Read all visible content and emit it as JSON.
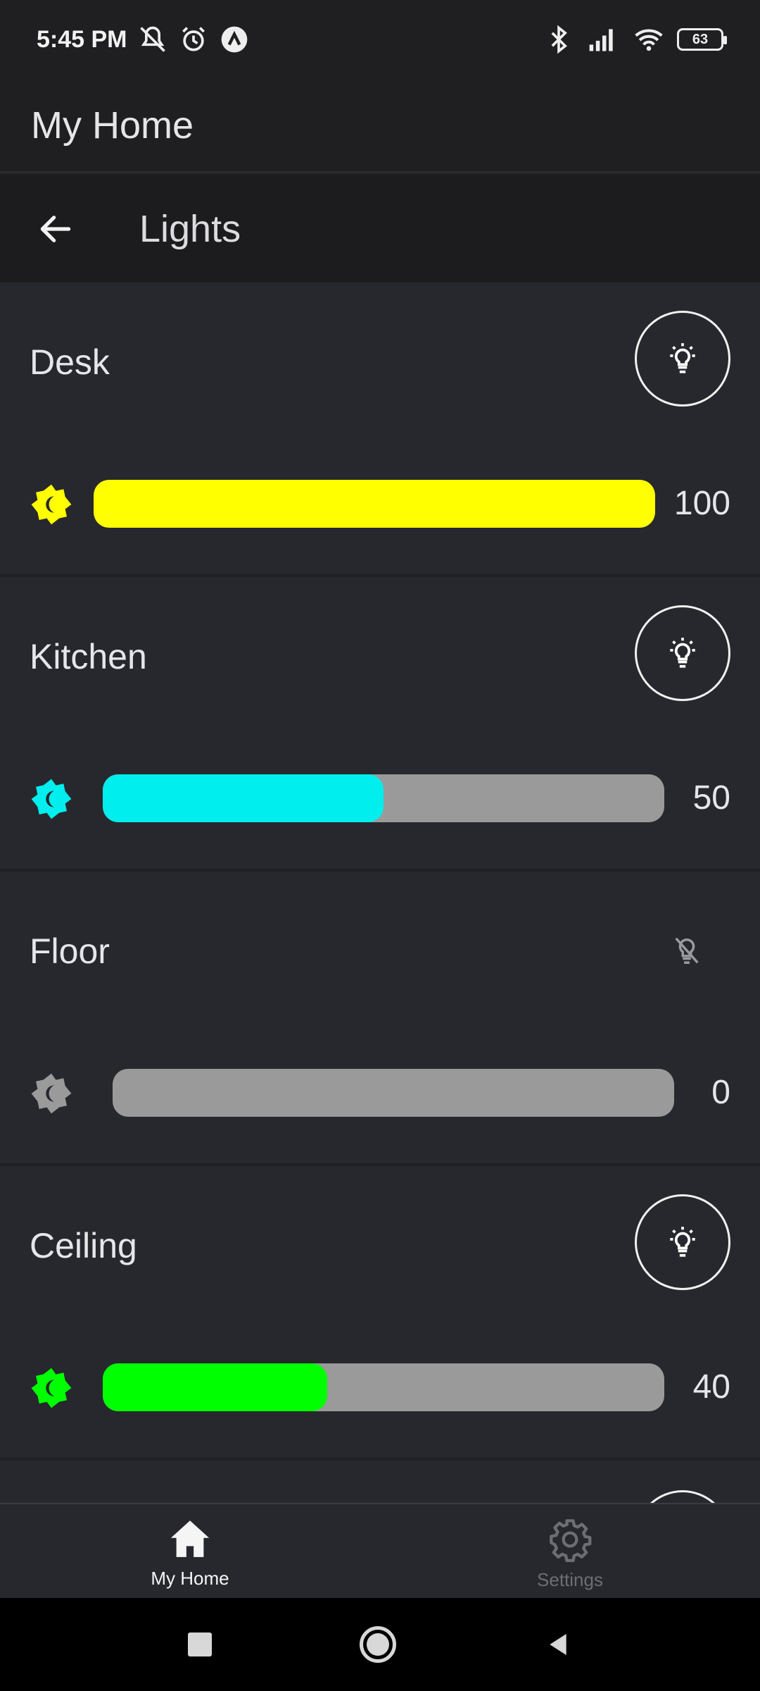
{
  "status": {
    "time": "5:45 PM",
    "battery": "63",
    "icons": [
      "mute-bell-icon",
      "alarm-icon",
      "app-notification-icon",
      "bluetooth-icon",
      "signal-icon",
      "wifi-icon",
      "battery-icon"
    ]
  },
  "appbar": {
    "title": "My Home"
  },
  "subbar": {
    "title": "Lights",
    "back_icon": "arrow-left-icon"
  },
  "lights": [
    {
      "name": "Desk",
      "value": "100",
      "level": 1.0,
      "color": "#ffff00",
      "on": true
    },
    {
      "name": "Kitchen",
      "value": "50",
      "level": 0.5,
      "color": "#00eeee",
      "on": true
    },
    {
      "name": "Floor",
      "value": "0",
      "level": 0.0,
      "color": "#9a9a9a",
      "on": false
    },
    {
      "name": "Ceiling",
      "value": "40",
      "level": 0.4,
      "color": "#00ff00",
      "on": true
    }
  ],
  "bottom_nav": {
    "home_label": "My Home",
    "settings_label": "Settings"
  },
  "colors": {
    "background": "#27282d",
    "appbar": "#1f1f21",
    "inactive": "#6d6e73",
    "track": "#9a9a9a"
  }
}
